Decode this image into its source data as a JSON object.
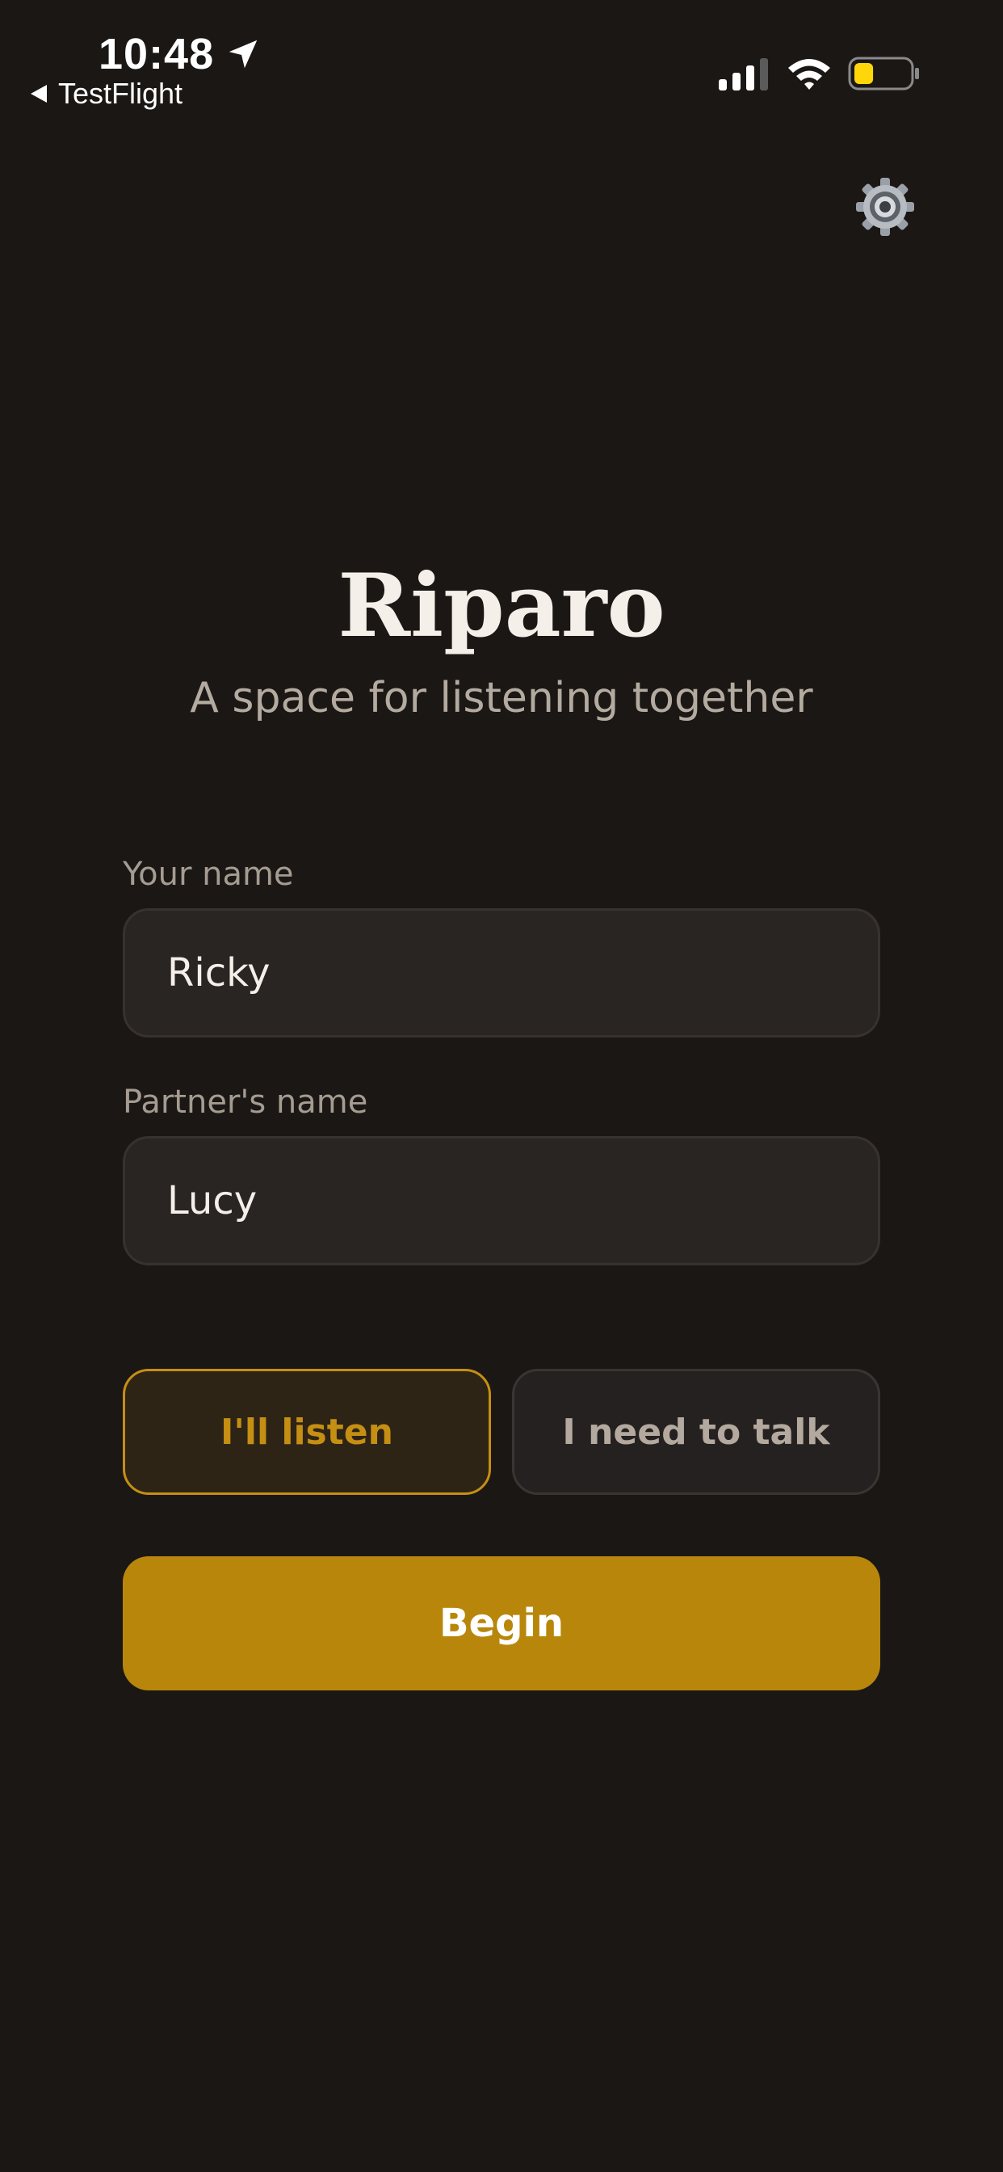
{
  "status_bar": {
    "time": "10:48",
    "back_label": "TestFlight",
    "location_icon": "location-arrow-icon",
    "signal_icon": "cellular-signal-icon",
    "wifi_icon": "wifi-icon",
    "battery_icon": "battery-icon",
    "battery_level": 0.35,
    "battery_color": "#ffd60a"
  },
  "header": {
    "settings_icon": "gear-icon"
  },
  "hero": {
    "title": "Riparo",
    "subtitle": "A space for listening together"
  },
  "form": {
    "your_name_label": "Your name",
    "your_name_value": "Ricky",
    "partner_name_label": "Partner's name",
    "partner_name_value": "Lucy"
  },
  "roles": {
    "listen_label": "I'll listen",
    "talk_label": "I need to talk",
    "selected": "listen"
  },
  "actions": {
    "begin_label": "Begin"
  },
  "colors": {
    "background": "#1b1715",
    "accent": "#b8860b",
    "selected_text": "#c58f13"
  }
}
